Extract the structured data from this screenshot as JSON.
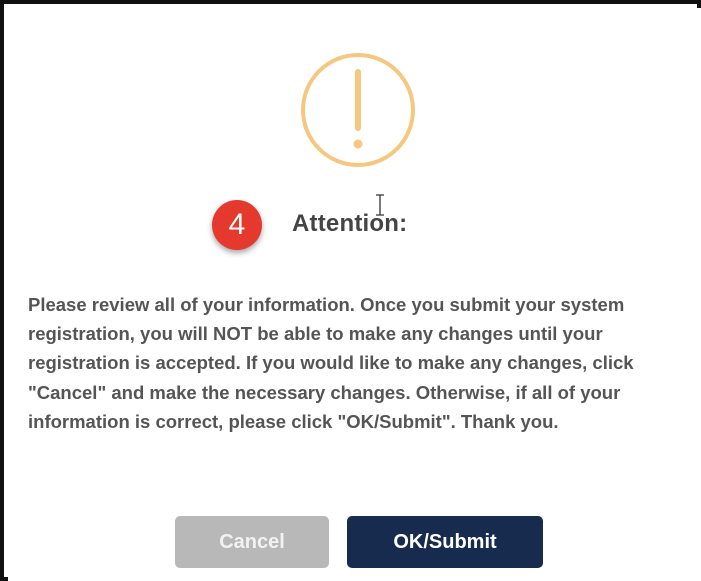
{
  "dialog": {
    "step_number": "4",
    "title": "Attention:",
    "message": "Please review all of your information. Once you submit your system registration, you will NOT be able to make any changes until your registration is accepted. If you would like to make any changes, click \"Cancel\" and make the necessary changes. Otherwise, if all of your information is correct, please click \"OK/Submit\". Thank you.",
    "cancel_label": "Cancel",
    "ok_label": "OK/Submit",
    "icon": "warning-exclamation-icon"
  },
  "colors": {
    "warning_icon": "#f6c77f",
    "badge": "#e5392e",
    "ok_button": "#172b4f",
    "cancel_button": "#b8b8b8",
    "text": "#555555"
  }
}
